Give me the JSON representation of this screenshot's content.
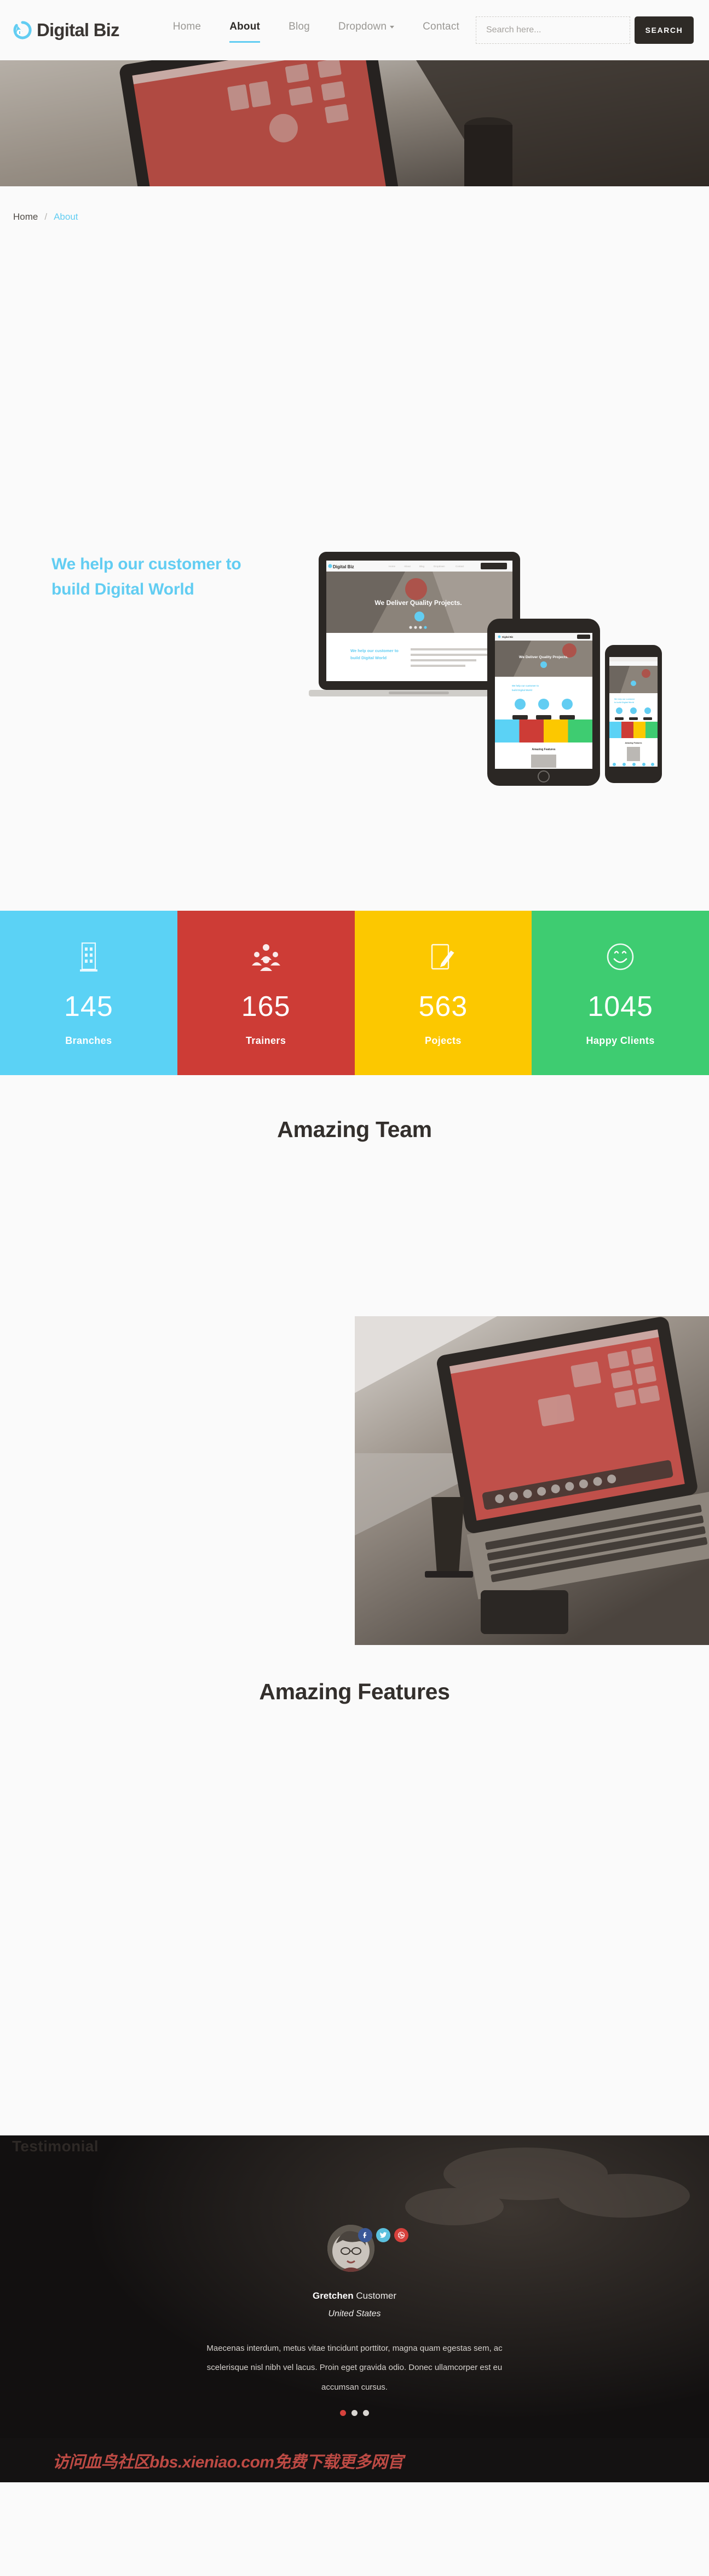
{
  "brand": {
    "name": "Digital Biz",
    "icon": "refresh-circle-icon",
    "accent": "#62cdf2"
  },
  "nav": {
    "items": [
      {
        "label": "Home",
        "active": false,
        "dropdown": false
      },
      {
        "label": "About",
        "active": true,
        "dropdown": false
      },
      {
        "label": "Blog",
        "active": false,
        "dropdown": false
      },
      {
        "label": "Dropdown",
        "active": false,
        "dropdown": true
      },
      {
        "label": "Contact",
        "active": false,
        "dropdown": false
      }
    ]
  },
  "search": {
    "placeholder": "Search here...",
    "value": "",
    "button_label": "SEARCH"
  },
  "breadcrumb": {
    "home": "Home",
    "separator": "/",
    "current": "About"
  },
  "hero": {
    "title_line1": "We help our customer to",
    "title_line2": "build Digital World",
    "mockup_caption": "We Deliver Quality Projects."
  },
  "counters": [
    {
      "value": "145",
      "label": "Branches",
      "color": "#5bd2f5",
      "icon": "building-icon"
    },
    {
      "value": "165",
      "label": "Trainers",
      "color": "#cd3c36",
      "icon": "users-group-icon"
    },
    {
      "value": "563",
      "label": "Pojects",
      "color": "#fcc800",
      "icon": "edit-pencil-icon"
    },
    {
      "value": "1045",
      "label": "Happy Clients",
      "color": "#3ecc71",
      "icon": "smiley-face-icon"
    }
  ],
  "team": {
    "title": "Amazing Team"
  },
  "features": {
    "title": "Amazing Features"
  },
  "testimonial": {
    "heading": "Testimonial",
    "name": "Gretchen",
    "role": "Customer",
    "country": "United States",
    "quote": "Maecenas interdum, metus vitae tincidunt porttitor, magna quam egestas sem, ac scelerisque nisl nibh vel lacus. Proin eget gravida odio. Donec ullamcorper est eu accumsan cursus.",
    "socials": [
      {
        "name": "facebook-icon",
        "color": "#3b5998"
      },
      {
        "name": "twitter-icon",
        "color": "#5bc0de"
      },
      {
        "name": "dribbble-icon",
        "color": "#d7413c"
      }
    ],
    "dots": [
      {
        "active": true
      },
      {
        "active": false
      },
      {
        "active": false
      }
    ]
  },
  "watermark": {
    "text": "访问血鸟社区bbs.xieniao.com免费下载更多网官"
  }
}
